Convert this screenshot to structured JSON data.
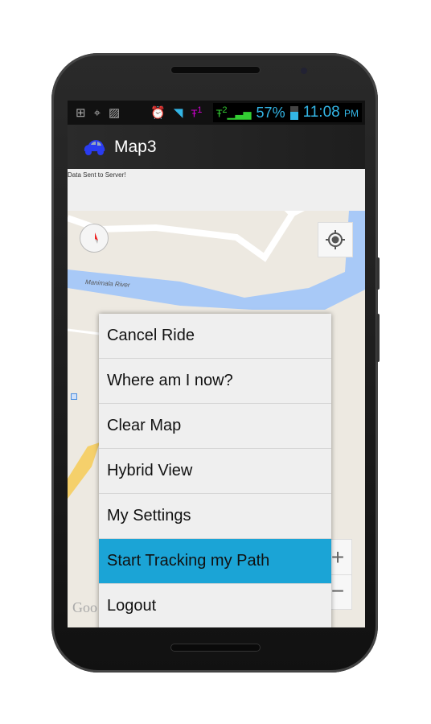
{
  "status_bar": {
    "icons": [
      "add-icon",
      "gps-icon",
      "image-icon",
      "alarm-icon",
      "wifi-icon",
      "signal-sim1-icon",
      "signal-sim2-icon",
      "battery-icon"
    ],
    "sim1": "1",
    "sim2": "2",
    "battery": "57%",
    "time": "11:08",
    "ampm": "PM"
  },
  "action_bar": {
    "title": "Map3",
    "icon": "car-icon"
  },
  "toast": "Data Sent to Server!",
  "map": {
    "river_label": "Manimala River",
    "attribution": "Goo",
    "zoom_in": "+",
    "zoom_out": "−"
  },
  "menu": {
    "items": [
      {
        "label": "Cancel Ride"
      },
      {
        "label": "Where am I now?"
      },
      {
        "label": "Clear Map"
      },
      {
        "label": "Hybrid View"
      },
      {
        "label": "My Settings"
      },
      {
        "label": "Start Tracking my Path",
        "selected": true
      },
      {
        "label": "Logout"
      }
    ],
    "highlight_color": "#1ba4d6"
  }
}
